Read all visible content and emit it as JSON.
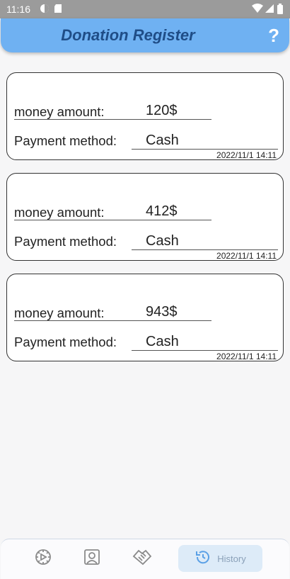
{
  "status_bar": {
    "time": "11:16"
  },
  "app_bar": {
    "title": "Donation Register",
    "help_label": "?"
  },
  "records": [
    {
      "money_label": "money amount:",
      "money_value": "120$",
      "payment_label": "Payment method:",
      "payment_value": "Cash",
      "timestamp": "2022/11/1 14:11"
    },
    {
      "money_label": "money amount:",
      "money_value": "412$",
      "payment_label": "Payment method:",
      "payment_value": "Cash",
      "timestamp": "2022/11/1 14:11"
    },
    {
      "money_label": "money amount:",
      "money_value": "943$",
      "payment_label": "Payment method:",
      "payment_value": "Cash",
      "timestamp": "2022/11/1 14:11"
    }
  ],
  "bottom_nav": {
    "items": [
      {
        "icon": "dashboard-icon"
      },
      {
        "icon": "profile-icon"
      },
      {
        "icon": "handshake-icon"
      },
      {
        "icon": "history-icon",
        "label": "History",
        "active": true
      }
    ]
  },
  "colors": {
    "app_bar": "#6fb1f2",
    "title": "#1f4d87",
    "nav_active_bg": "#ddebf8"
  }
}
